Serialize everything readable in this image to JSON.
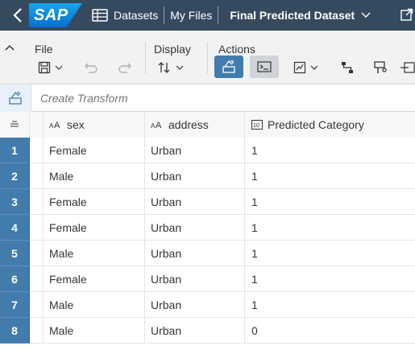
{
  "shell": {
    "logo_text": "SAP",
    "breadcrumbs": [
      "Datasets",
      "My Files"
    ],
    "title": "Final Predicted Dataset"
  },
  "toolbar": {
    "groups": [
      {
        "label": "File"
      },
      {
        "label": "Display"
      },
      {
        "label": "Actions"
      }
    ]
  },
  "transform": {
    "placeholder": "Create Transform"
  },
  "grid": {
    "columns": [
      {
        "label": "sex",
        "type_icon": "AA"
      },
      {
        "label": "address",
        "type_icon": "AA"
      },
      {
        "label": "Predicted Category",
        "type_icon": "10"
      }
    ],
    "rows": [
      {
        "num": "1",
        "sex": "Female",
        "address": "Urban",
        "pred": "1"
      },
      {
        "num": "2",
        "sex": "Male",
        "address": "Urban",
        "pred": "1"
      },
      {
        "num": "3",
        "sex": "Female",
        "address": "Urban",
        "pred": "1"
      },
      {
        "num": "4",
        "sex": "Female",
        "address": "Urban",
        "pred": "1"
      },
      {
        "num": "5",
        "sex": "Male",
        "address": "Urban",
        "pred": "1"
      },
      {
        "num": "6",
        "sex": "Female",
        "address": "Urban",
        "pred": "1"
      },
      {
        "num": "7",
        "sex": "Male",
        "address": "Urban",
        "pred": "1"
      },
      {
        "num": "8",
        "sex": "Male",
        "address": "Urban",
        "pred": "0"
      }
    ]
  },
  "colors": {
    "shell_bg": "#354a5f",
    "accent": "#427cac",
    "toolbar_bg": "#f2f2f2"
  }
}
